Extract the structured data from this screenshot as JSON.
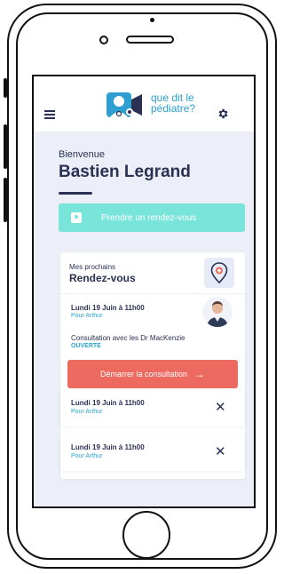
{
  "app": {
    "logo_line1": "que dit le",
    "logo_line2": "pédiatre?"
  },
  "header": {
    "greeting": "Bienvenue",
    "user_name": "Bastien Legrand"
  },
  "actions": {
    "book_label": "Prendre un rendez-vous"
  },
  "upcoming": {
    "title_line1": "Mes prochains",
    "title_line2": "Rendez-vous",
    "primary": {
      "date": "Lundi 19 Juin à 11h00",
      "patient": "Pour Arthur",
      "description": "Consultation avec les Dr MacKenzie",
      "status": "OUVERTE",
      "start_label": "Démarrer la consultation",
      "arrow": "→"
    },
    "others": [
      {
        "date": "Lundi 19 Juin à 11h00",
        "patient": "Pour Arthur",
        "close": "✕"
      },
      {
        "date": "Lundi 19 Juin à 11h00",
        "patient": "Pour Arthur",
        "close": "✕"
      }
    ]
  },
  "colors": {
    "accent_teal": "#79e4d9",
    "accent_red": "#ec6a5f",
    "navy": "#2b3153",
    "link_blue": "#2aa3cf"
  },
  "icons": [
    "hamburger-menu-icon",
    "doctor-logo-icon",
    "gear-icon",
    "calendar-icon",
    "location-pin-icon",
    "arrow-right-icon",
    "close-icon"
  ]
}
